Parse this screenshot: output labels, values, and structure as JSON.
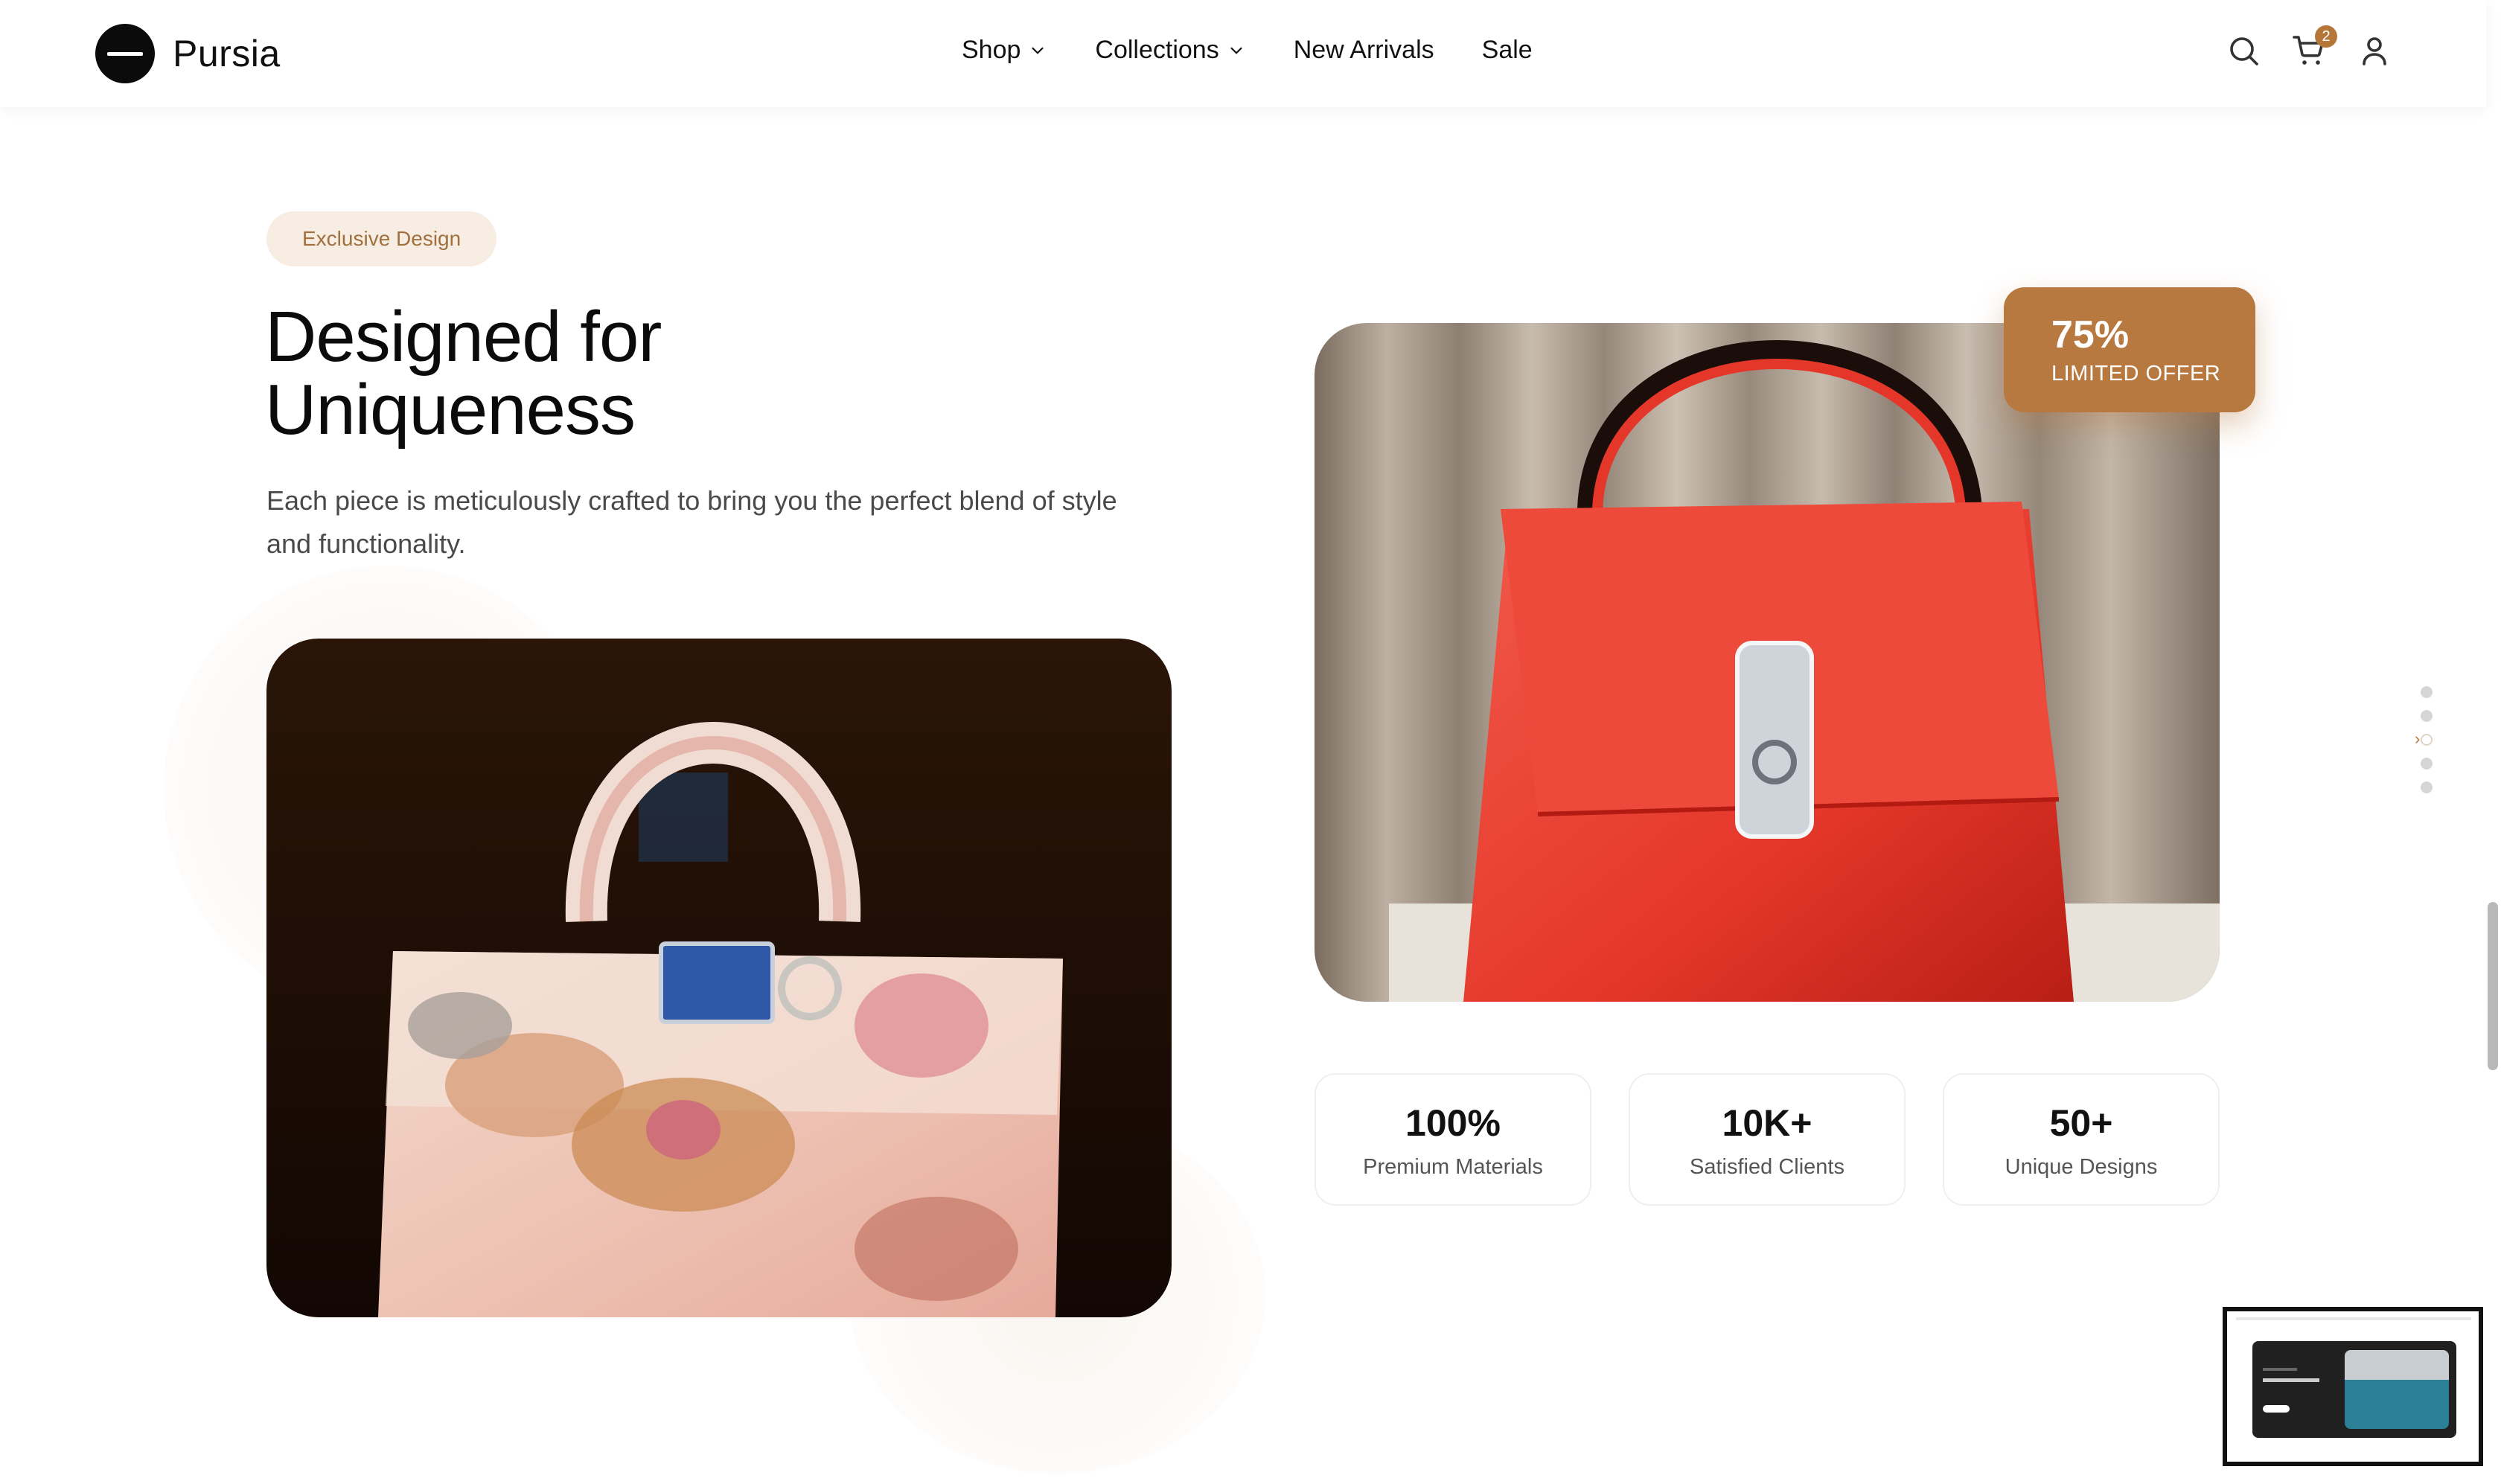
{
  "brand": {
    "name": "Pursia",
    "logo_icon": "circle-dash-logo"
  },
  "nav": {
    "items": [
      {
        "label": "Shop",
        "has_dropdown": true
      },
      {
        "label": "Collections",
        "has_dropdown": true
      },
      {
        "label": "New Arrivals",
        "has_dropdown": false
      },
      {
        "label": "Sale",
        "has_dropdown": false
      }
    ]
  },
  "header_icons": {
    "search": "search-icon",
    "cart": "cart-icon",
    "cart_count": "2",
    "account": "user-icon"
  },
  "hero": {
    "badge": "Exclusive Design",
    "title_line1": "Designed for",
    "title_line2": "Uniqueness",
    "description": "Each piece is meticulously crafted to bring you the perfect blend of style and functionality."
  },
  "offer": {
    "percent": "75%",
    "label": "LIMITED OFFER"
  },
  "stats": [
    {
      "value": "100%",
      "label": "Premium Materials"
    },
    {
      "value": "10K+",
      "label": "Satisfied Clients"
    },
    {
      "value": "50+",
      "label": "Unique Designs"
    }
  ],
  "slider": {
    "dot_count": 5,
    "active_index": 2
  },
  "colors": {
    "accent": "#b5763a",
    "pill_bg": "#f7ede3",
    "text_dark": "#0b0b0b",
    "text_muted": "#4a4a4a"
  }
}
